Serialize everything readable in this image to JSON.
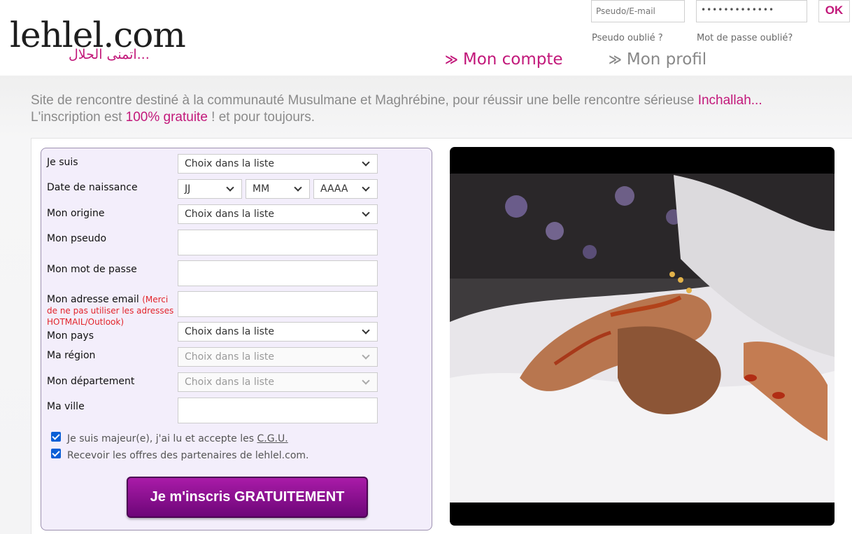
{
  "logo": {
    "text": "lehlel.com",
    "arabic": "...اتمنى الحلال"
  },
  "login": {
    "pseudo_placeholder": "Pseudo/E-mail",
    "password_value": "•••••••••••••",
    "ok_label": "OK",
    "forgot_pseudo": "Pseudo oublié ?",
    "forgot_password": "Mot de passe oublié?"
  },
  "nav": {
    "chevron": "≫",
    "mon_compte": "Mon compte",
    "mon_profil": "Mon profil"
  },
  "tagline": {
    "line1_a": "Site de rencontre destiné à la communauté Musulmane et Maghrébine, pour réussir une belle rencontre sérieuse ",
    "line1_b": "Inchallah...",
    "line2_a": "L'inscription est ",
    "line2_b": "100% gratuite",
    "line2_c": " ! et pour toujours."
  },
  "form": {
    "je_suis": {
      "label": "Je suis",
      "value": "Choix dans la liste"
    },
    "naissance": {
      "label": "Date de naissance",
      "day": "JJ",
      "month": "MM",
      "year": "AAAA"
    },
    "origine": {
      "label": "Mon origine",
      "value": "Choix dans la liste"
    },
    "pseudo": {
      "label": "Mon pseudo"
    },
    "mot_de_passe": {
      "label": "Mon mot de passe"
    },
    "email": {
      "label": "Mon adresse email",
      "note": "(Merci de ne pas utiliser les adresses HOTMAIL/Outlook)"
    },
    "pays": {
      "label": "Mon pays",
      "value": "Choix dans la liste"
    },
    "region": {
      "label": "Ma région",
      "value": "Choix dans la liste"
    },
    "departement": {
      "label": "Mon département",
      "value": "Choix dans la liste"
    },
    "ville": {
      "label": "Ma ville"
    },
    "check_majeur": {
      "text": "Je suis majeur(e), j'ai lu et accepte les ",
      "link": "C.G.U.",
      "checked": true
    },
    "check_offres": {
      "text": "Recevoir les offres des partenaires de lehlel.com.",
      "checked": true
    },
    "submit": "Je m'inscris GRATUITEMENT"
  },
  "colors": {
    "accent": "#c2187a",
    "button": "#8a0f92",
    "form_bg": "#f3eefb"
  }
}
